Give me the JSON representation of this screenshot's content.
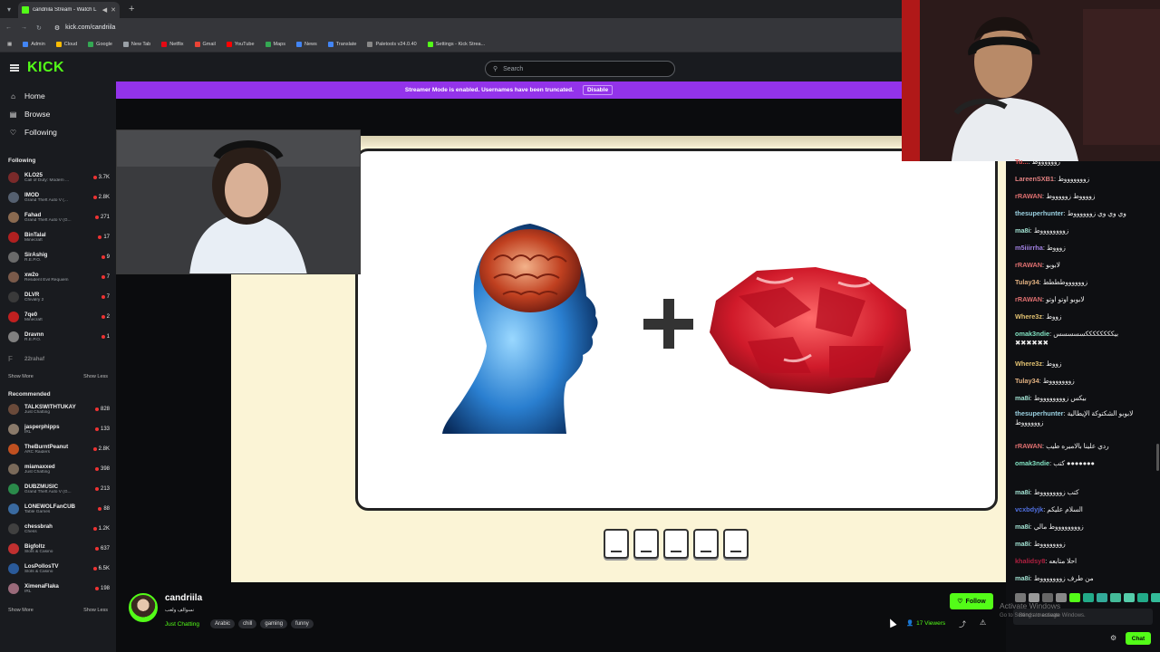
{
  "browser": {
    "tab_title": "candriila Stream - Watch L",
    "url": "kick.com/candriila",
    "bookmarks": [
      "Admin",
      "Cloud",
      "Google",
      "New Tab",
      "Netflix",
      "Gmail",
      "YouTube",
      "Maps",
      "News",
      "Translate",
      "Paletools v24.0.40",
      "Settings - Kick Strea..."
    ]
  },
  "header": {
    "logo": "KICK",
    "search_placeholder": "Search"
  },
  "banner": {
    "text": "Streamer Mode is enabled. Usernames have been truncated.",
    "button": "Disable"
  },
  "sidebar": {
    "nav": [
      {
        "label": "Home",
        "icon": "home-icon"
      },
      {
        "label": "Browse",
        "icon": "browse-icon"
      },
      {
        "label": "Following",
        "icon": "heart-icon"
      }
    ],
    "following_title": "Following",
    "following": [
      {
        "name": "KLO25",
        "category": "Call of Duty: Modern ...",
        "viewers": "3.7K",
        "color": "#7a2a2a"
      },
      {
        "name": "IMOD",
        "category": "Grand Theft Auto V (...",
        "viewers": "2.8K",
        "color": "#556070"
      },
      {
        "name": "Fahad",
        "category": "Grand Theft Auto V (G...",
        "viewers": "271",
        "color": "#8a6a50"
      },
      {
        "name": "BinTalal",
        "category": "Minecraft",
        "viewers": "17",
        "color": "#b02020"
      },
      {
        "name": "SirAshig",
        "category": "R.E.P.O.",
        "viewers": "9",
        "color": "#6a6a6a"
      },
      {
        "name": "xw2o",
        "category": "Resident Evil Requiem",
        "viewers": "7",
        "color": "#7a5a4a"
      },
      {
        "name": "DLVR",
        "category": "Chivalry 2",
        "viewers": "7",
        "color": "#3a3a3a"
      },
      {
        "name": "7qe0",
        "category": "Minecraft",
        "viewers": "2",
        "color": "#c02020"
      },
      {
        "name": "Dravnn",
        "category": "R.E.P.O.",
        "viewers": "1",
        "color": "#808080"
      }
    ],
    "offline_channel": "22rahaf",
    "show_more": "Show More",
    "show_less": "Show Less",
    "recommended_title": "Recommended",
    "recommended": [
      {
        "name": "TALKSWITHTUKAY",
        "category": "Just Chatting",
        "viewers": "828",
        "color": "#6a4a3a"
      },
      {
        "name": "jasperphipps",
        "category": "IRL",
        "viewers": "133",
        "color": "#8a7a6a"
      },
      {
        "name": "TheBurntPeanut",
        "category": "ARC Raiders",
        "viewers": "2.8K",
        "color": "#c05020"
      },
      {
        "name": "miamaxxed",
        "category": "Just Chatting",
        "viewers": "398",
        "color": "#7a6a5a"
      },
      {
        "name": "DUBZMUSIC",
        "category": "Grand Theft Auto V (G...",
        "viewers": "213",
        "color": "#2a8a4a"
      },
      {
        "name": "LONEWOLFanCUB",
        "category": "Table Games",
        "viewers": "88",
        "color": "#3a6aa0"
      },
      {
        "name": "chessbrah",
        "category": "Chess",
        "viewers": "1.2K",
        "color": "#404040"
      },
      {
        "name": "Bigfoltz",
        "category": "Slots & Casino",
        "viewers": "637",
        "color": "#c03030"
      },
      {
        "name": "LosPollosTV",
        "category": "Slots & Casino",
        "viewers": "6.5K",
        "color": "#2a5a9a"
      },
      {
        "name": "XimenaFlaka",
        "category": "IRL",
        "viewers": "198",
        "color": "#9a6a7a"
      }
    ]
  },
  "stream": {
    "name": "candriila",
    "title": "نسوالف ولعب",
    "category": "Just Chatting",
    "tags": [
      "Arabic",
      "chill",
      "gaming",
      "funny"
    ],
    "follow_label": "Follow",
    "viewers": "17 Viewers",
    "puzzle_plus": "+",
    "blank_count": 5
  },
  "chat": {
    "messages": [
      {
        "user": "Tu...",
        "text": "زووووووط",
        "color": "#e05050"
      },
      {
        "user": "LareenSXB1",
        "text": "زوووووووط",
        "color": "#e08080"
      },
      {
        "user": "rRAWAN",
        "text": "زووووط زوووووط",
        "color": "#e07070"
      },
      {
        "user": "thesuperhunter",
        "text": "وي وي وي زووووووط",
        "color": "#9ad0e0"
      },
      {
        "user": "ma8i",
        "text": "زووووووووط",
        "color": "#a0e0d0"
      },
      {
        "user": "m5iiirrha",
        "text": "زوووط",
        "color": "#a080e0"
      },
      {
        "user": "rRAWAN",
        "text": "لابوبو",
        "color": "#e07070"
      },
      {
        "user": "Tulay34",
        "text": "زووووووطططط",
        "color": "#e0b080"
      },
      {
        "user": "rRAWAN",
        "text": "لابوبو اوتو اوتو",
        "color": "#e07070"
      },
      {
        "user": "Where3z",
        "text": "زووط",
        "color": "#e0c070"
      },
      {
        "user": "omak3ndie",
        "text": "بيككككككككسسسسس ✖✖✖✖✖✖",
        "color": "#80e0c0"
      },
      {
        "user": "Where3z",
        "text": "زووط",
        "color": "#e0c070"
      },
      {
        "user": "Tulay34",
        "text": "زوووووووط",
        "color": "#e0b080"
      },
      {
        "user": "ma8i",
        "text": "بيكس زووووووووط",
        "color": "#a0e0d0"
      },
      {
        "user": "thesuperhunter",
        "text": "لابوبو الشكتوكة الإيطالية زووووووط",
        "color": "#9ad0e0"
      },
      {
        "user": "rRAWAN",
        "text": "ردي علينا بالاميره طيب",
        "color": "#e07070"
      },
      {
        "user": "omak3ndie",
        "text": "كتب ●●●●●●●",
        "color": "#80e0c0"
      },
      {
        "user": "ma8i",
        "text": "كتب زوووووووط",
        "color": "#a0e0d0"
      },
      {
        "user": "vcxbdyjk",
        "text": "السلام عليكم",
        "color": "#5070e0"
      },
      {
        "user": "ma8i",
        "text": "زووووووووط مالي",
        "color": "#a0e0d0"
      },
      {
        "user": "ma8i",
        "text": "زوووووووط",
        "color": "#a0e0d0"
      },
      {
        "user": "khalidsy8",
        "text": "احلا متابعه",
        "color": "#b02040"
      },
      {
        "user": "ma8i",
        "text": "من طرف زوووووووط",
        "color": "#a0e0d0"
      }
    ],
    "input_placeholder": "Send a message",
    "chat_button": "Chat",
    "watermark_title": "Activate Windows",
    "watermark_sub": "Go to Settings to activate Windows."
  }
}
